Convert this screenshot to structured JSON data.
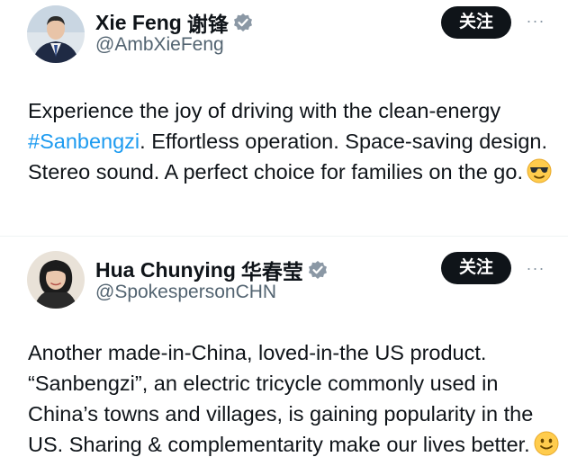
{
  "tweets": [
    {
      "display_name": "Xie Feng",
      "cn_name": "谢锋",
      "handle": "@AmbXieFeng",
      "follow_label": "关注",
      "more_label": "···",
      "body_start": "Experience the joy of driving with the clean-energy ",
      "hashtag": "#Sanbengzi",
      "body_end": ". Effortless operation. Space-saving design. Stereo sound. A perfect choice for families on the go.",
      "emoji": "smiling-face-with-sunglasses"
    },
    {
      "display_name": "Hua Chunying",
      "cn_name": "华春莹",
      "handle": "@SpokespersonCHN",
      "follow_label": "关注",
      "more_label": "···",
      "body": "Another made-in-China, loved-in-the US product. “Sanbengzi”, an electric tricycle commonly used in China’s towns and villages, is gaining popularity in the US. Sharing & complementarity make our lives better.",
      "emoji": "smiling-face"
    }
  ],
  "colors": {
    "verified_badge": "#8b98a5",
    "hashtag": "#1d9bf0",
    "follow_button": "#0f1419",
    "handle_text": "#536471"
  }
}
